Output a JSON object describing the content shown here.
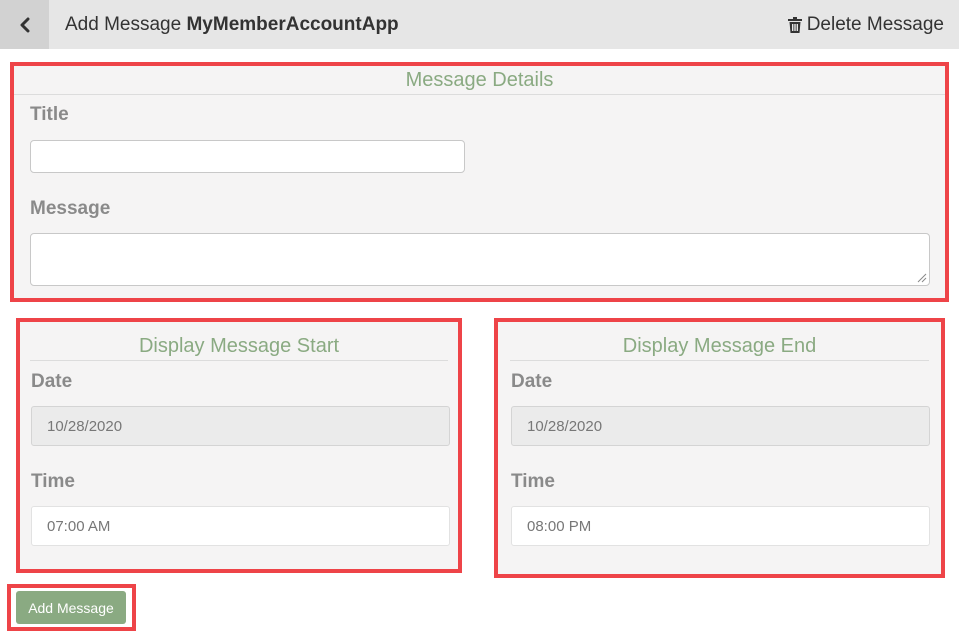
{
  "header": {
    "back_icon": "chevron-left-icon",
    "title_prefix": "Add Message",
    "title_app": "MyMemberAccountApp",
    "delete_icon": "trash-icon",
    "delete_label": "Delete Message"
  },
  "message_details": {
    "heading": "Message Details",
    "title_label": "Title",
    "title_value": "",
    "message_label": "Message",
    "message_value": ""
  },
  "display_start": {
    "heading": "Display Message Start",
    "date_label": "Date",
    "date_value": "10/28/2020",
    "time_label": "Time",
    "time_value": "07:00 AM"
  },
  "display_end": {
    "heading": "Display Message End",
    "date_label": "Date",
    "date_value": "10/28/2020",
    "time_label": "Time",
    "time_value": "08:00 PM"
  },
  "actions": {
    "add_label": "Add Message"
  },
  "colors": {
    "accent_green": "#8aaa82",
    "highlight_red": "#ee4448",
    "panel_bg": "#f5f4f4"
  }
}
